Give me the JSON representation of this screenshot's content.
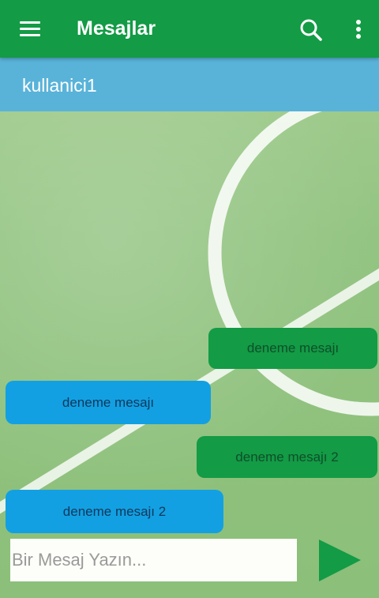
{
  "app_bar": {
    "title": "Mesajlar",
    "menu_icon": "hamburger-menu-icon",
    "search_icon": "search-icon",
    "more_icon": "more-vertical-icon",
    "color": "#139b45"
  },
  "user_bar": {
    "username": "kullanici1",
    "color": "#59b3d9"
  },
  "messages": [
    {
      "direction": "sent",
      "text": "deneme mesajı"
    },
    {
      "direction": "received",
      "text": "deneme mesajı"
    },
    {
      "direction": "sent",
      "text": "deneme mesajı 2"
    },
    {
      "direction": "received",
      "text": "deneme mesajı 2"
    }
  ],
  "composer": {
    "placeholder": "Bir Mesaj Yazın...",
    "value": "",
    "send_icon": "send-icon"
  },
  "colors": {
    "sent_bubble": "#139b45",
    "received_bubble": "#12a0e3",
    "field_green": "#93c482"
  }
}
